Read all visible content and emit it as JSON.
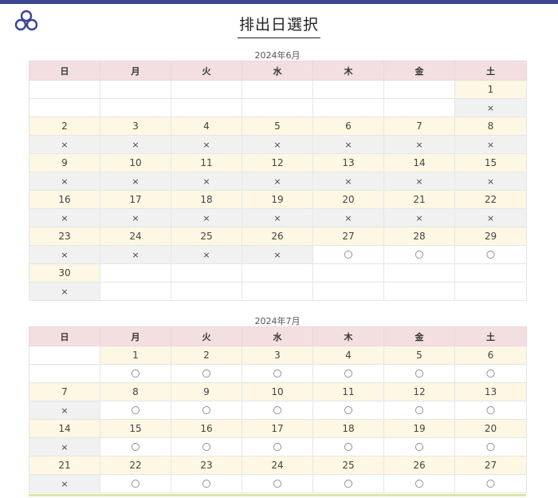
{
  "page_title": "排出日選択",
  "weekdays": [
    "日",
    "月",
    "火",
    "水",
    "木",
    "金",
    "土"
  ],
  "months": [
    {
      "label": "2024年6月",
      "weeks": [
        {
          "days": [
            "",
            "",
            "",
            "",
            "",
            "",
            "1"
          ],
          "marks": [
            "",
            "",
            "",
            "",
            "",
            "",
            "×"
          ]
        },
        {
          "days": [
            "2",
            "3",
            "4",
            "5",
            "6",
            "7",
            "8"
          ],
          "marks": [
            "×",
            "×",
            "×",
            "×",
            "×",
            "×",
            "×"
          ]
        },
        {
          "days": [
            "9",
            "10",
            "11",
            "12",
            "13",
            "14",
            "15"
          ],
          "marks": [
            "×",
            "×",
            "×",
            "×",
            "×",
            "×",
            "×"
          ]
        },
        {
          "days": [
            "16",
            "17",
            "18",
            "19",
            "20",
            "21",
            "22"
          ],
          "marks": [
            "×",
            "×",
            "×",
            "×",
            "×",
            "×",
            "×"
          ]
        },
        {
          "days": [
            "23",
            "24",
            "25",
            "26",
            "27",
            "28",
            "29"
          ],
          "marks": [
            "×",
            "×",
            "×",
            "×",
            "〇",
            "〇",
            "〇"
          ]
        },
        {
          "days": [
            "30",
            "",
            "",
            "",
            "",
            "",
            ""
          ],
          "marks": [
            "×",
            "",
            "",
            "",
            "",
            "",
            ""
          ]
        }
      ]
    },
    {
      "label": "2024年7月",
      "weeks": [
        {
          "days": [
            "",
            "1",
            "2",
            "3",
            "4",
            "5",
            "6"
          ],
          "marks": [
            "",
            "〇",
            "〇",
            "〇",
            "〇",
            "〇",
            "〇"
          ]
        },
        {
          "days": [
            "7",
            "8",
            "9",
            "10",
            "11",
            "12",
            "13"
          ],
          "marks": [
            "×",
            "〇",
            "〇",
            "〇",
            "〇",
            "〇",
            "〇"
          ]
        },
        {
          "days": [
            "14",
            "15",
            "16",
            "17",
            "18",
            "19",
            "20"
          ],
          "marks": [
            "×",
            "〇",
            "〇",
            "〇",
            "〇",
            "〇",
            "〇"
          ]
        },
        {
          "days": [
            "21",
            "22",
            "23",
            "24",
            "25",
            "26",
            "27"
          ],
          "marks": [
            "×",
            "〇",
            "〇",
            "〇",
            "〇",
            "〇",
            "〇"
          ]
        }
      ]
    }
  ],
  "colors": {
    "accent": "#3b4693",
    "header_bg": "#f3dfe2",
    "day_bg": "#fdf7e3",
    "unavailable_bg": "#f1f1f1"
  },
  "icons": {
    "logo": "trefoil-logo-icon"
  }
}
